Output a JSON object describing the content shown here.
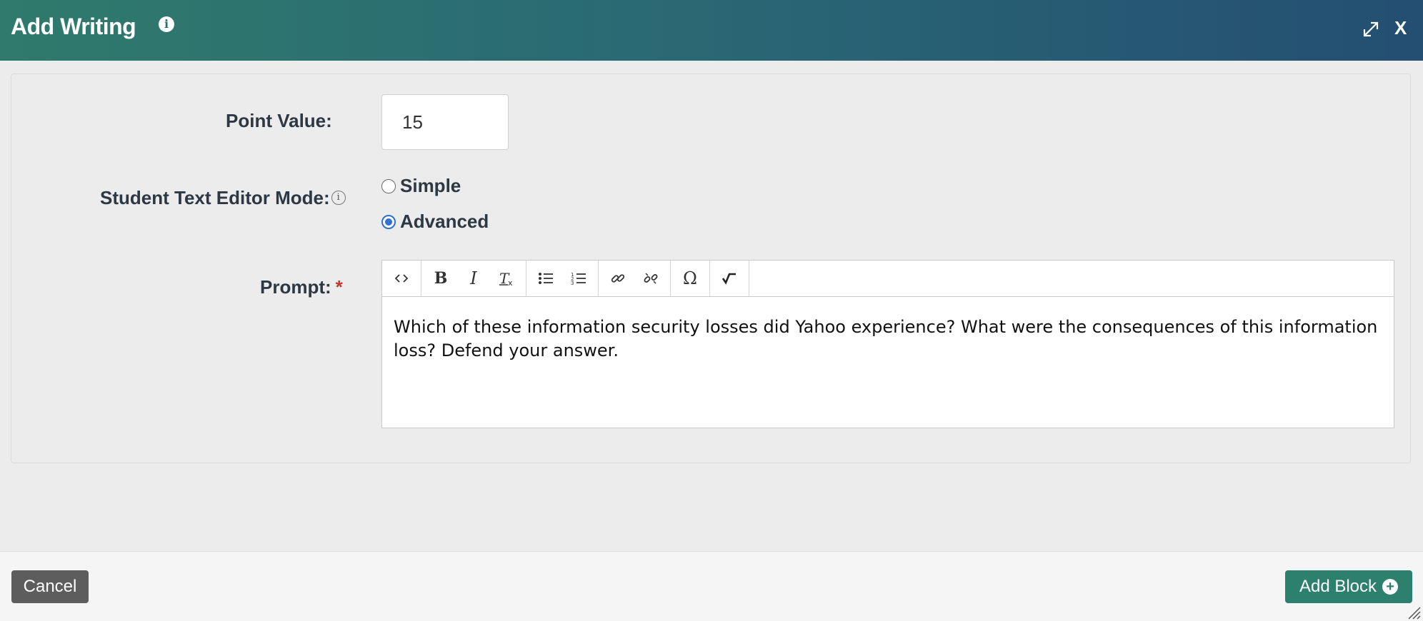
{
  "header": {
    "title": "Add Writing",
    "info_glyph": "i",
    "close_glyph": "X"
  },
  "form": {
    "point_value_label": "Point Value:",
    "point_value": "15",
    "editor_mode_label": "Student Text Editor Mode:",
    "editor_mode_info_glyph": "i",
    "modes": [
      {
        "label": "Simple",
        "selected": false
      },
      {
        "label": "Advanced",
        "selected": true
      }
    ],
    "prompt_label": "Prompt:",
    "prompt_required": "*",
    "prompt_text": "Which of these information security losses did Yahoo experience? What were the consequences of this information loss? Defend your answer."
  },
  "toolbar": {
    "groups": [
      [
        {
          "icon": "source-code-icon",
          "glyph": "<>"
        }
      ],
      [
        {
          "icon": "bold-icon",
          "glyph": "B"
        },
        {
          "icon": "italic-icon",
          "glyph": "I"
        },
        {
          "icon": "remove-format-icon",
          "glyph": "Tx"
        }
      ],
      [
        {
          "icon": "bulleted-list-icon",
          "glyph": "•≡"
        },
        {
          "icon": "numbered-list-icon",
          "glyph": "1≡"
        }
      ],
      [
        {
          "icon": "link-icon",
          "glyph": "🔗"
        },
        {
          "icon": "unlink-icon",
          "glyph": "⛓"
        }
      ],
      [
        {
          "icon": "special-character-icon",
          "glyph": "Ω"
        }
      ],
      [
        {
          "icon": "math-equation-icon",
          "glyph": "√"
        }
      ]
    ]
  },
  "footer": {
    "cancel_label": "Cancel",
    "add_block_label": "Add Block",
    "add_icon_glyph": "+"
  },
  "colors": {
    "header_start": "#2f7a6c",
    "header_end": "#244e72",
    "add_button": "#2d7f6e",
    "cancel_button": "#5d5d5d",
    "radio_accent": "#2f6fd6",
    "required": "#c0392b"
  }
}
